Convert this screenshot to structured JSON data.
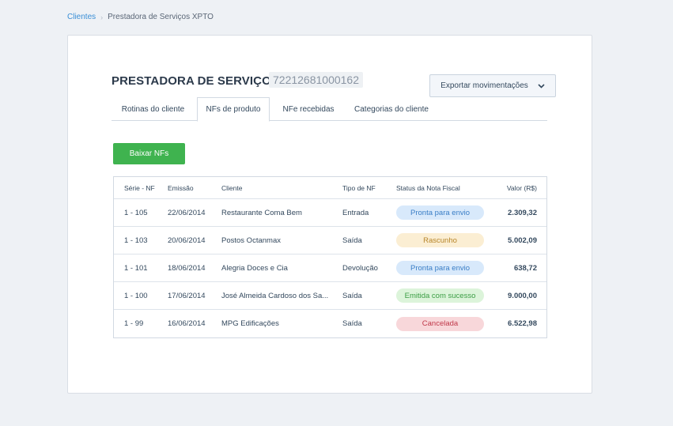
{
  "breadcrumb": {
    "root": "Clientes",
    "separator": "›",
    "current": "Prestadora de Serviços XPTO"
  },
  "client": {
    "name": "PRESTADORA DE SERVIÇOS...",
    "document": "72212681000162"
  },
  "actions": {
    "export_label": "Exportar movimentações",
    "download_label": "Baixar NFs"
  },
  "tabs": [
    {
      "label": "Rotinas do cliente",
      "active": false
    },
    {
      "label": "NFs de produto",
      "active": true
    },
    {
      "label": "NFe recebidas",
      "active": false
    },
    {
      "label": "Categorias do cliente",
      "active": false
    }
  ],
  "table": {
    "headers": {
      "serie": "Série - NF",
      "emissao": "Emissão",
      "cliente": "Cliente",
      "tipo": "Tipo de NF",
      "status": "Status da Nota Fiscal",
      "valor": "Valor (R$)"
    },
    "rows": [
      {
        "serie": "1 - 105",
        "emissao": "22/06/2014",
        "cliente": "Restaurante Coma Bem",
        "tipo": "Entrada",
        "status": "Pronta para envio",
        "status_color": "blue",
        "valor": "2.309,32"
      },
      {
        "serie": "1 - 103",
        "emissao": "20/06/2014",
        "cliente": "Postos Octanmax",
        "tipo": "Saída",
        "status": "Rascunho",
        "status_color": "yellow",
        "valor": "5.002,09"
      },
      {
        "serie": "1 - 101",
        "emissao": "18/06/2014",
        "cliente": "Alegria Doces e Cia",
        "tipo": "Devolução",
        "status": "Pronta para envio",
        "status_color": "blue",
        "valor": "638,72"
      },
      {
        "serie": "1 - 100",
        "emissao": "17/06/2014",
        "cliente": "José Almeida Cardoso dos Sa...",
        "tipo": "Saída",
        "status": "Emitida com sucesso",
        "status_color": "green",
        "valor": "9.000,00"
      },
      {
        "serie": "1 - 99",
        "emissao": "16/06/2014",
        "cliente": "MPG Edificações",
        "tipo": "Saída",
        "status": "Cancelada",
        "status_color": "red",
        "valor": "6.522,98"
      }
    ]
  },
  "colors": {
    "accent": "#3a8fd6",
    "primary_button": "#3fb34f",
    "badge_blue": "#d8e9fb",
    "badge_yellow": "#fbeed3",
    "badge_green": "#dcf4da",
    "badge_red": "#f8d7da"
  },
  "icons": {
    "export_dropdown": "chevron-down-icon"
  }
}
